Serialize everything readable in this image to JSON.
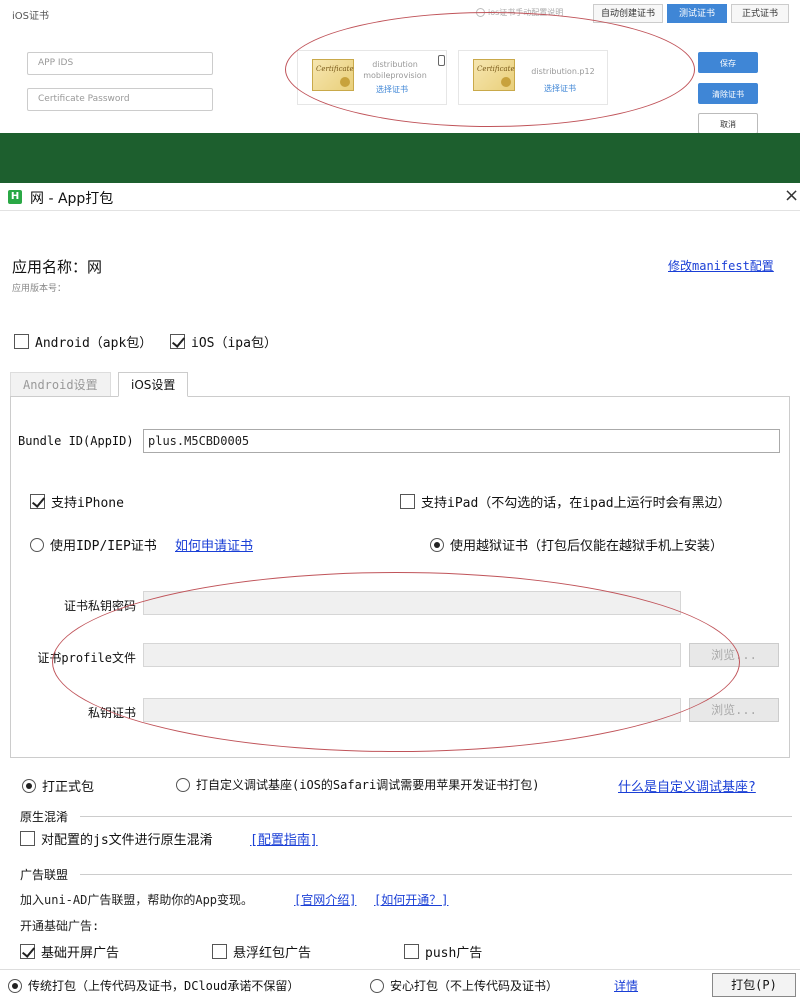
{
  "top_panel": {
    "title": "iOS证书",
    "mini_radio_label": "ios证书手动配置说明",
    "tabs": [
      "自动创建证书",
      "测试证书",
      "正式证书"
    ],
    "app_ids_placeholder": "APP IDS",
    "cert_password_placeholder": "Certificate Password",
    "card1": {
      "name_line1": "distribution",
      "name_line2": "mobileprovision",
      "link": "选择证书"
    },
    "card2": {
      "name": "distribution.p12",
      "link": "选择证书"
    },
    "cert_image_text": "Certificate",
    "buttons": {
      "save": "保存",
      "clear": "清除证书",
      "cancel": "取消"
    }
  },
  "dialog": {
    "logo": "H",
    "title": "网 - App打包",
    "close": "×",
    "app_name": "应用名称：网",
    "app_version": "应用版本号：",
    "manifest_link": "修改manifest配置",
    "platforms": {
      "android": "Android（apk包）",
      "ios": "iOS（ipa包）"
    },
    "tabs": {
      "android": "Android设置",
      "ios": "iOS设置"
    },
    "ios": {
      "bundle_label": "Bundle ID(AppID)",
      "bundle_value": "plus.M5CBD0005",
      "support_iphone": "支持iPhone",
      "support_ipad": "支持iPad（不勾选的话，在ipad上运行时会有黑边）",
      "use_idp": "使用IDP/IEP证书",
      "how_to_apply": "如何申请证书",
      "use_jailbreak": "使用越狱证书（打包后仅能在越狱手机上安装）",
      "key_password_label": "证书私钥密码",
      "profile_label": "证书profile文件",
      "private_cert_label": "私钥证书",
      "browse": "浏览..."
    },
    "build_type": {
      "formal": "打正式包",
      "custom_base": "打自定义调试基座(iOS的Safari调试需要用苹果开发证书打包)",
      "what_is_custom": "什么是自定义调试基座?"
    },
    "obfuscation": {
      "title": "原生混淆",
      "option": "对配置的js文件进行原生混淆",
      "guide": "[配置指南]"
    },
    "ads": {
      "title": "广告联盟",
      "intro": "加入uni-AD广告联盟，帮助你的App变现。",
      "official_link": "[官网介绍]",
      "how_link": "[如何开通？]",
      "basic_label": "开通基础广告:",
      "splash": "基础开屏广告",
      "float_redpack": "悬浮红包广告",
      "push": "push广告"
    },
    "footer": {
      "traditional": "传统打包（上传代码及证书，DCloud承诺不保留）",
      "safe": "安心打包（不上传代码及证书）",
      "details": "详情",
      "pack_button": "打包(P)"
    }
  }
}
